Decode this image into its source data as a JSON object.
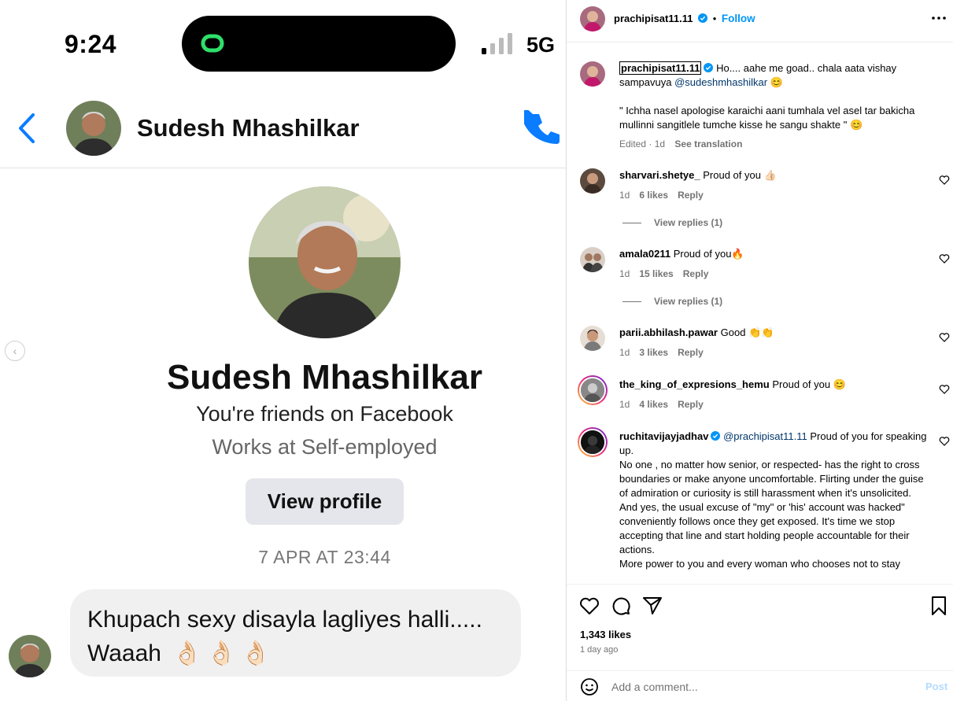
{
  "screenshot": {
    "status_bar": {
      "time": "9:24",
      "network": "5G"
    },
    "chat_header": {
      "name": "Sudesh Mhashilkar"
    },
    "profile_card": {
      "name": "Sudesh Mhashilkar",
      "friends_text": "You're friends on Facebook",
      "works_text": "Works at Self-employed",
      "view_profile": "View profile"
    },
    "date_stamp": "7 APR AT 23:44",
    "message": {
      "line1": "Khupach sexy disayla lagliyes halli.....",
      "line2": "Waaah",
      "emoji": "👌🏻"
    }
  },
  "post": {
    "header": {
      "username": "prachipisat11.11",
      "dot": "•",
      "follow": "Follow"
    },
    "caption": {
      "username": "prachipisat11.11",
      "text1": "Ho.... aahe me goad.. chala aata vishay sampavuya ",
      "mention": "@sudeshmhashilkar",
      "emoji1": "😊",
      "text2": "\" Ichha nasel apologise karaichi aani tumhala vel asel tar bakicha mullinni sangitlele tumche kisse he sangu shakte \" ",
      "emoji2": "😊",
      "edited": "Edited · 1d",
      "see_translation": "See translation"
    },
    "comments": [
      {
        "username": "sharvari.shetye_",
        "text": "Proud of you 👍🏻",
        "age": "1d",
        "likes": "6 likes",
        "reply": "Reply",
        "view_replies": "View replies (1)"
      },
      {
        "username": "amala0211",
        "text": "Proud of you🔥",
        "age": "1d",
        "likes": "15 likes",
        "reply": "Reply",
        "view_replies": "View replies (1)"
      },
      {
        "username": "parii.abhilash.pawar",
        "text": "Good 👏👏",
        "age": "1d",
        "likes": "3 likes",
        "reply": "Reply"
      },
      {
        "username": "the_king_of_expresions_hemu",
        "text": "Proud of you 😊",
        "age": "1d",
        "likes": "4 likes",
        "reply": "Reply"
      },
      {
        "username": "ruchitavijayjadhav",
        "mention": "@prachipisat11.11",
        "text": " Proud of you for speaking up.",
        "para1": "No one , no matter how senior, or respected- has the right to cross boundaries or make anyone uncomfortable. Flirting under the guise of admiration or curiosity is still harassment when it's unsolicited.",
        "para2": "And yes, the usual excuse of \"my\" or 'his' account was hacked\" conveniently follows once they get exposed. It's time we stop accepting that line and start holding people accountable for their actions.",
        "para3": "More power to you and every woman who chooses not to stay"
      }
    ],
    "likes_count": "1,343 likes",
    "time_ago": "1 day ago",
    "add_comment_placeholder": "Add a comment...",
    "post_button": "Post"
  },
  "colors": {
    "ig_blue": "#0095f6",
    "messenger_blue": "#0a7cff",
    "meta_gray": "#737373"
  }
}
